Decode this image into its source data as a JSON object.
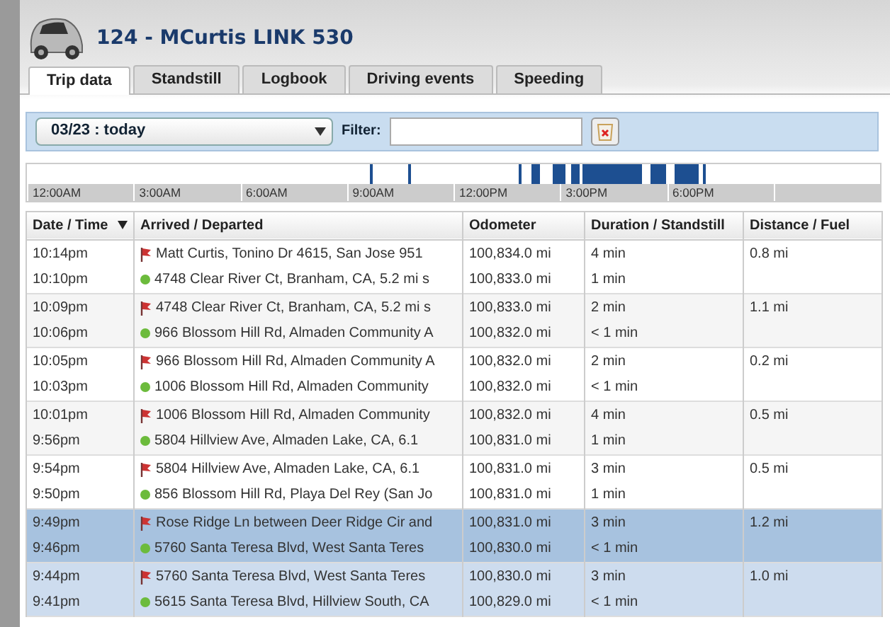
{
  "header": {
    "title": "124 - MCurtis LINK 530"
  },
  "tabs": [
    {
      "label": "Trip data",
      "selected": true
    },
    {
      "label": "Standstill",
      "selected": false
    },
    {
      "label": "Logbook",
      "selected": false
    },
    {
      "label": "Driving events",
      "selected": false
    },
    {
      "label": "Speeding",
      "selected": false
    }
  ],
  "toolbar": {
    "date_value": "03/23 : today",
    "filter_label": "Filter:"
  },
  "timeline": {
    "labels": [
      "12:00AM",
      "3:00AM",
      "6:00AM",
      "9:00AM",
      "12:00PM",
      "3:00PM",
      "6:00PM"
    ]
  },
  "table": {
    "columns": [
      {
        "label": "Date / Time",
        "sorted": true
      },
      {
        "label": "Arrived / Departed",
        "sorted": false
      },
      {
        "label": "Odometer",
        "sorted": false
      },
      {
        "label": "Duration / Standstill",
        "sorted": false
      },
      {
        "label": "Distance / Fuel",
        "sorted": false
      }
    ],
    "rows": [
      {
        "arrived_time": "10:14pm",
        "departed_time": "10:10pm",
        "arrived_place": "Matt Curtis, Tonino Dr 4615, San Jose 951",
        "departed_place": "4748 Clear River Ct, Branham, CA, 5.2 mi s",
        "odometer_arrived": "100,834.0 mi",
        "odometer_departed": "100,833.0 mi",
        "duration": "4 min",
        "standstill": "1 min",
        "distance": "0.8 mi",
        "selected": false,
        "hovered": false
      },
      {
        "arrived_time": "10:09pm",
        "departed_time": "10:06pm",
        "arrived_place": "4748 Clear River Ct, Branham, CA, 5.2 mi s",
        "departed_place": "966 Blossom Hill Rd, Almaden Community A",
        "odometer_arrived": "100,833.0 mi",
        "odometer_departed": "100,832.0 mi",
        "duration": "2 min",
        "standstill": "< 1 min",
        "distance": "1.1 mi",
        "selected": false,
        "hovered": false
      },
      {
        "arrived_time": "10:05pm",
        "departed_time": "10:03pm",
        "arrived_place": "966 Blossom Hill Rd, Almaden Community A",
        "departed_place": "1006 Blossom Hill Rd, Almaden Community",
        "odometer_arrived": "100,832.0 mi",
        "odometer_departed": "100,832.0 mi",
        "duration": "2 min",
        "standstill": "< 1 min",
        "distance": "0.2 mi",
        "selected": false,
        "hovered": false
      },
      {
        "arrived_time": "10:01pm",
        "departed_time": "9:56pm",
        "arrived_place": "1006 Blossom Hill Rd, Almaden Community",
        "departed_place": "5804 Hillview Ave, Almaden Lake, CA, 6.1",
        "odometer_arrived": "100,832.0 mi",
        "odometer_departed": "100,831.0 mi",
        "duration": "4 min",
        "standstill": "1 min",
        "distance": "0.5 mi",
        "selected": false,
        "hovered": false
      },
      {
        "arrived_time": "9:54pm",
        "departed_time": "9:50pm",
        "arrived_place": "5804 Hillview Ave, Almaden Lake, CA, 6.1",
        "departed_place": "856 Blossom Hill Rd, Playa Del Rey  (San Jo",
        "odometer_arrived": "100,831.0 mi",
        "odometer_departed": "100,831.0 mi",
        "duration": "3 min",
        "standstill": "1 min",
        "distance": "0.5 mi",
        "selected": false,
        "hovered": false
      },
      {
        "arrived_time": "9:49pm",
        "departed_time": "9:46pm",
        "arrived_place": "Rose Ridge Ln between Deer Ridge Cir and",
        "departed_place": "5760 Santa Teresa Blvd, West Santa Teres",
        "odometer_arrived": "100,831.0 mi",
        "odometer_departed": "100,830.0 mi",
        "duration": "3 min",
        "standstill": "< 1 min",
        "distance": "1.2 mi",
        "selected": true,
        "hovered": false
      },
      {
        "arrived_time": "9:44pm",
        "departed_time": "9:41pm",
        "arrived_place": "5760 Santa Teresa Blvd, West Santa Teres",
        "departed_place": "5615 Santa Teresa Blvd, Hillview South, CA",
        "odometer_arrived": "100,830.0 mi",
        "odometer_departed": "100,829.0 mi",
        "duration": "3 min",
        "standstill": "< 1 min",
        "distance": "1.0 mi",
        "selected": false,
        "hovered": true
      }
    ]
  }
}
